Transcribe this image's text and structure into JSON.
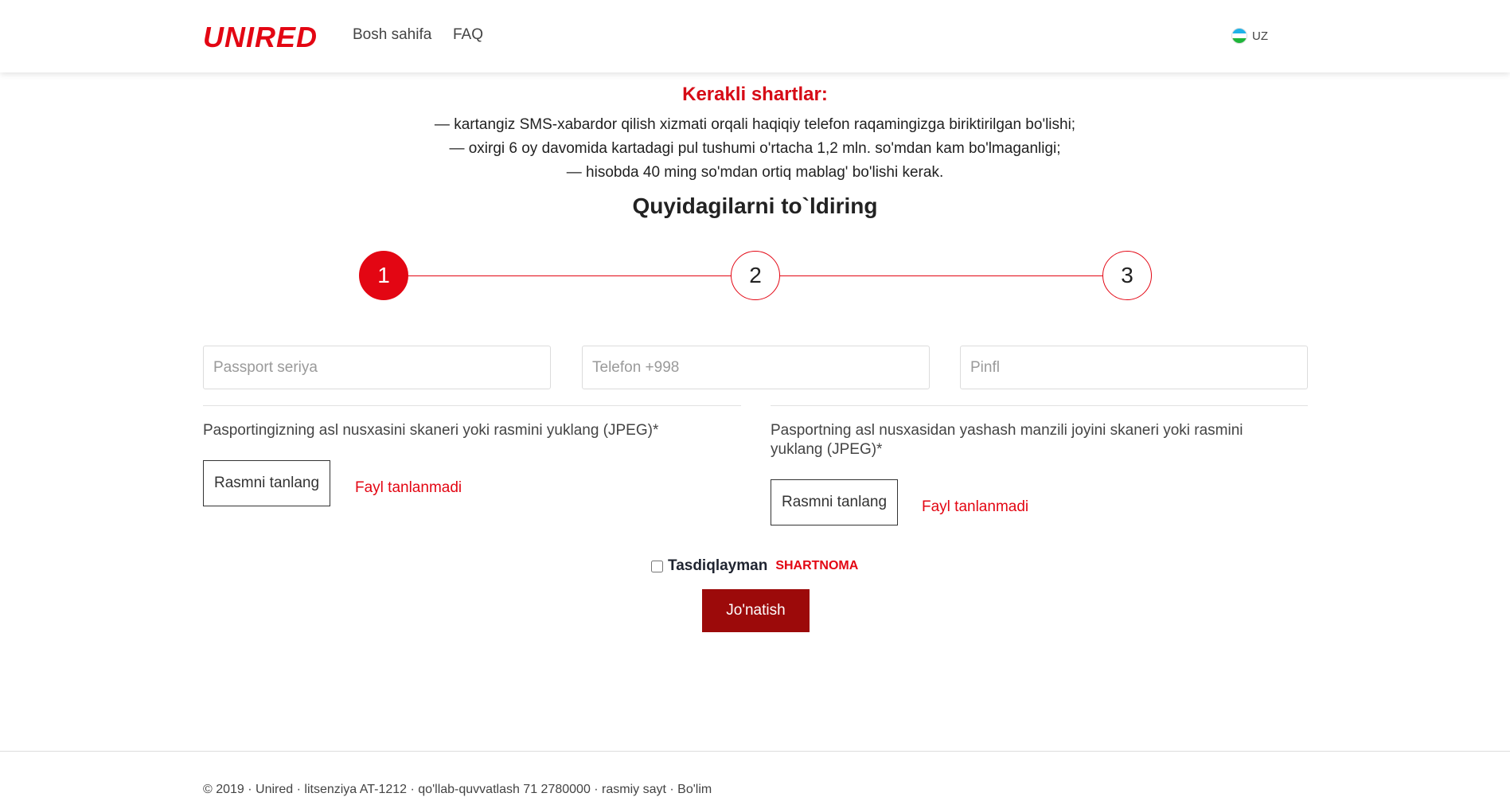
{
  "header": {
    "logo": "UNIRED",
    "nav": [
      "Bosh sahifa",
      "FAQ"
    ],
    "language": "UZ"
  },
  "requirements": {
    "title": "Kerakli shartlar:",
    "lines": [
      "— kartangiz SMS-xabardor qilish xizmati orqali haqiqiy telefon raqamingizga biriktirilgan bo'lishi;",
      "— oxirgi 6 oy davomida kartadagi pul tushumi o'rtacha 1,2 mln. so'mdan kam bo'lmaganligi;",
      "— hisobda 40 ming so'mdan ortiq mablag' bo'lishi kerak."
    ]
  },
  "form": {
    "title": "Quyidagilarni to`ldiring",
    "steps": [
      "1",
      "2",
      "3"
    ],
    "active_step": 1,
    "inputs": {
      "passport_placeholder": "Passport seriya",
      "phone_placeholder": "Telefon +998",
      "pinfl_placeholder": "Pinfl"
    },
    "upload_passport": {
      "label": "Pasportingizning asl nusxasini skaneri yoki rasmini yuklang (JPEG)*",
      "button": "Rasmni tanlang",
      "status": "Fayl tanlanmadi"
    },
    "upload_address": {
      "label": "Pasportning asl nusxasidan yashash manzili joyini skaneri yoki rasmini yuklang (JPEG)*",
      "button": "Rasmni tanlang",
      "status": "Fayl tanlanmadi"
    },
    "agree_label": "Tasdiqlayman",
    "agree_link": "SHARTNOMA",
    "submit": "Jo'natish"
  },
  "footer": {
    "text": "© 2019 · Unired · litsenziya AT-1212 · qo'llab-quvvatlash 71 2780000 · rasmiy sayt · Bo'lim"
  },
  "colors": {
    "brand_red": "#e30613",
    "submit_dark_red": "#9c0a0a"
  }
}
